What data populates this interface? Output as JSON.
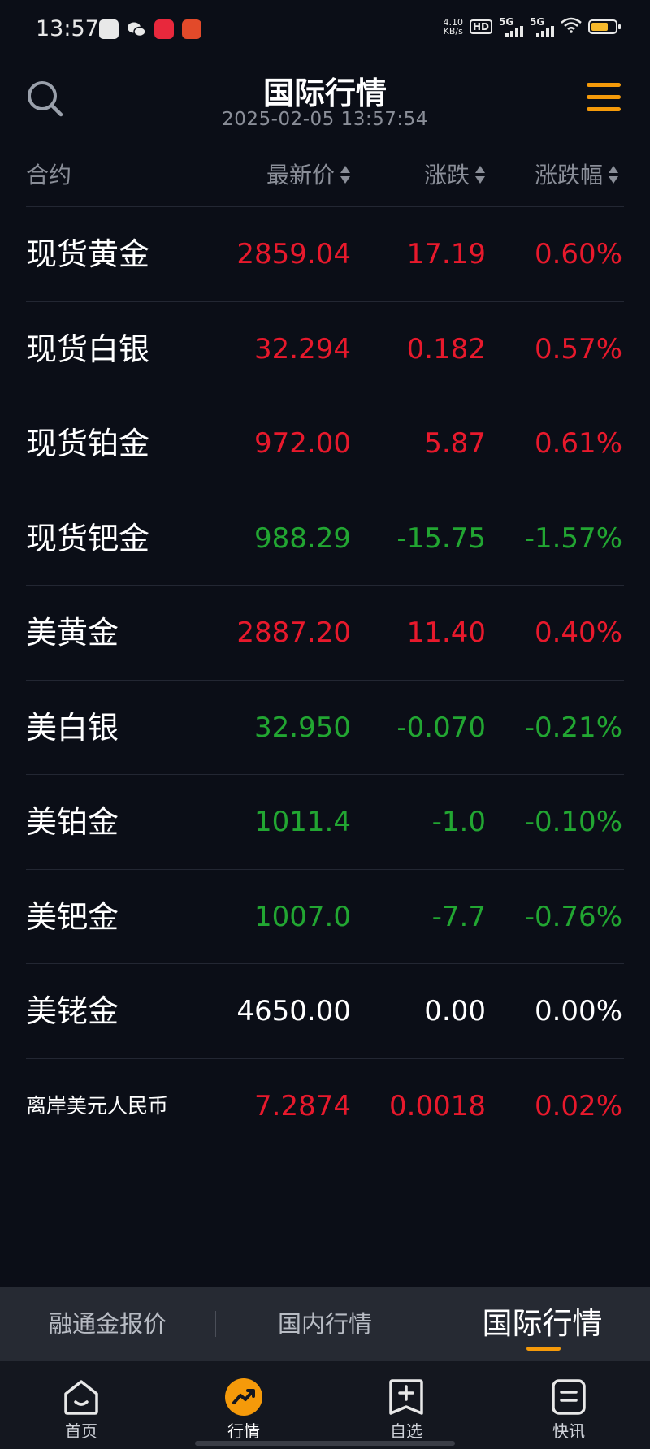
{
  "status_bar": {
    "time": "13:57",
    "net_speed_value": "4.10",
    "net_speed_unit": "KB/s",
    "hd_label": "HD",
    "sim1_label": "5G",
    "sim2_label": "5G"
  },
  "header": {
    "title": "国际行情",
    "datetime": "2025-02-05 13:57:54"
  },
  "columns": {
    "name": "合约",
    "price": "最新价",
    "change": "涨跌",
    "change_pct": "涨跌幅"
  },
  "rows": [
    {
      "name": "现货黄金",
      "price": "2859.04",
      "change": "17.19",
      "pct": "0.60%",
      "trend": "up"
    },
    {
      "name": "现货白银",
      "price": "32.294",
      "change": "0.182",
      "pct": "0.57%",
      "trend": "up"
    },
    {
      "name": "现货铂金",
      "price": "972.00",
      "change": "5.87",
      "pct": "0.61%",
      "trend": "up"
    },
    {
      "name": "现货钯金",
      "price": "988.29",
      "change": "-15.75",
      "pct": "-1.57%",
      "trend": "down"
    },
    {
      "name": "美黄金",
      "price": "2887.20",
      "change": "11.40",
      "pct": "0.40%",
      "trend": "up"
    },
    {
      "name": "美白银",
      "price": "32.950",
      "change": "-0.070",
      "pct": "-0.21%",
      "trend": "down"
    },
    {
      "name": "美铂金",
      "price": "1011.4",
      "change": "-1.0",
      "pct": "-0.10%",
      "trend": "down"
    },
    {
      "name": "美钯金",
      "price": "1007.0",
      "change": "-7.7",
      "pct": "-0.76%",
      "trend": "down"
    },
    {
      "name": "美铑金",
      "price": "4650.00",
      "change": "0.00",
      "pct": "0.00%",
      "trend": "flat"
    },
    {
      "name": "离岸美元人民币",
      "price": "7.2874",
      "change": "0.0018",
      "pct": "0.02%",
      "trend": "up"
    }
  ],
  "segment_tabs": [
    {
      "label": "融通金报价",
      "active": false
    },
    {
      "label": "国内行情",
      "active": false
    },
    {
      "label": "国际行情",
      "active": true
    }
  ],
  "bottom_nav": [
    {
      "label": "首页",
      "icon": "home-icon",
      "active": false
    },
    {
      "label": "行情",
      "icon": "trend-icon",
      "active": true
    },
    {
      "label": "自选",
      "icon": "add-favorite-icon",
      "active": false
    },
    {
      "label": "快讯",
      "icon": "news-icon",
      "active": false
    }
  ],
  "colors": {
    "background": "#0b0e17",
    "up": "#e8192c",
    "down": "#22a632",
    "flat": "#ffffff",
    "accent": "#f59a0a"
  }
}
